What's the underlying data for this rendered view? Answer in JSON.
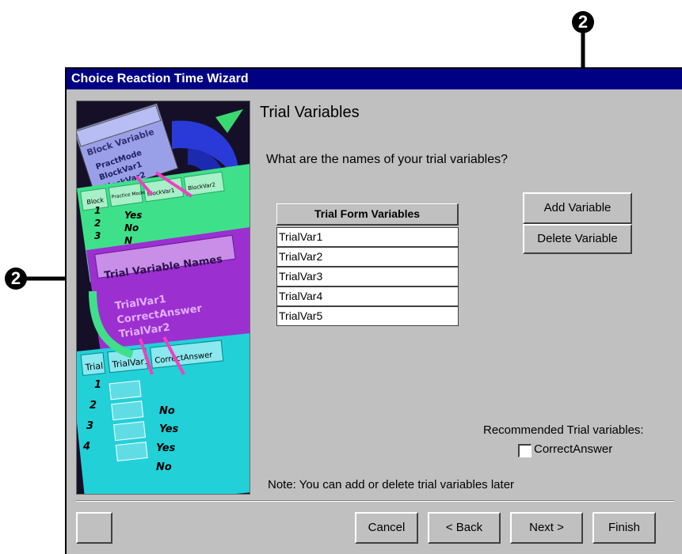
{
  "window": {
    "title": "Choice Reaction Time Wizard"
  },
  "page": {
    "heading": "Trial Variables",
    "question": "What are the names of your trial variables?"
  },
  "table": {
    "header": "Trial Form Variables",
    "rows": [
      "TrialVar1",
      "TrialVar2",
      "TrialVar3",
      "TrialVar4",
      "TrialVar5"
    ]
  },
  "buttons": {
    "add_variable": "Add Variable",
    "delete_variable": "Delete Variable",
    "cancel": "Cancel",
    "back": "< Back",
    "next": "Next >",
    "finish": "Finish"
  },
  "recommended": {
    "label": "Recommended Trial variables:",
    "checkbox_label": "CorrectAnswer",
    "checked": false
  },
  "note": "Note: You can add or delete trial variables later",
  "callouts": {
    "top": "2",
    "left": "2"
  },
  "illustration": {
    "block_card_title": "Block Variable",
    "block_card_lines": [
      "PractMode",
      "BlockVar1",
      "BlockVar2"
    ],
    "block_table_headers": [
      "Block",
      "Practice Mode",
      "BlockVar1",
      "BlockVar2"
    ],
    "block_rows": [
      [
        "1",
        "Yes"
      ],
      [
        "2",
        "No"
      ],
      [
        "3",
        "N"
      ]
    ],
    "trial_names_title": "Trial Variable Names",
    "trial_names_lines": [
      "TrialVar1",
      "CorrectAnswer",
      "TrialVar2"
    ],
    "trial_table_headers": [
      "Trial",
      "TrialVar1",
      "CorrectAnswer"
    ],
    "trial_rows": [
      [
        "1",
        ""
      ],
      [
        "2",
        "No"
      ],
      [
        "3",
        "Yes"
      ],
      [
        "4",
        "Yes"
      ],
      [
        "",
        "No"
      ]
    ]
  },
  "colors": {
    "titlebar": "#000084",
    "dialog_bg": "#c0c0c0",
    "illus_purple": "#9c2fd0",
    "illus_green": "#3fe08a",
    "illus_cyan": "#22d0d8",
    "illus_magenta": "#f040c0"
  }
}
